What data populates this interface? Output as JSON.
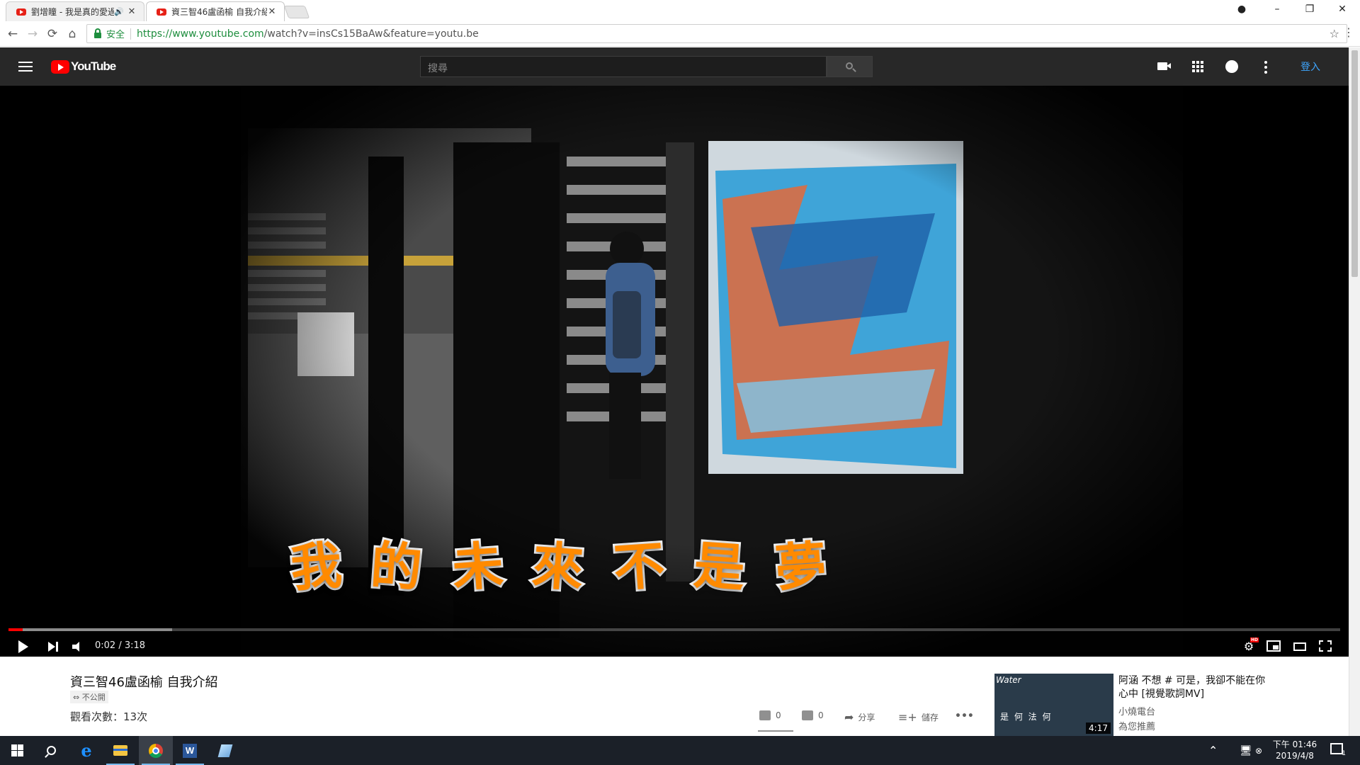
{
  "browser": {
    "tabs": [
      {
        "title": "劉增瞳 - 我是真的愛過",
        "active": false
      },
      {
        "title": "資三智46盧函榆 自我介紹",
        "active": true
      }
    ],
    "window_controls": {
      "minimize": "–",
      "restore": "❐",
      "close": "✕",
      "account": "●"
    },
    "nav": {
      "back": "←",
      "forward": "→",
      "reload": "⟳",
      "home": "⌂"
    },
    "security_label": "安全",
    "url_scheme_host": "https://www.youtube.com",
    "url_rest": "/watch?v=insCs15BaAw&feature=youtu.be",
    "bookmark_icon": "☆",
    "menu_icon": "⋮"
  },
  "youtube": {
    "logo_text": "YouTube",
    "search_placeholder": "搜尋",
    "signin_label": "登入",
    "header_icons": [
      "upload-video-icon",
      "apps-icon",
      "messages-icon",
      "settings-more-icon"
    ]
  },
  "player": {
    "caption_chars": [
      "我",
      "的",
      "未",
      "來",
      "不",
      "是",
      "夢"
    ],
    "time_display": "0:02 / 3:18",
    "progress": {
      "played_fraction": 0.0105,
      "buffered_fraction": 0.123
    },
    "hd_badge": "HD",
    "settings_icon": "⚙"
  },
  "video": {
    "title": "資三智46盧函榆 自我介紹",
    "privacy": "⇔ 不公開",
    "views": "觀看次數：13次",
    "likes": "0",
    "dislikes": "0",
    "share_label": "分享",
    "save_label": "儲存",
    "more_label": "•••"
  },
  "recommendation": {
    "title": "阿涵 不想 # 可是，我卻不能在你心中 [視覺歌詞MV]",
    "channel": "小燒電台",
    "reason": "為您推薦",
    "duration": "4:17",
    "thumb_watermark": "Water",
    "thumb_text": "是 何 法 何"
  },
  "taskbar": {
    "clock_time": "下午 01:46",
    "clock_date": "2019/4/8",
    "word_icon_letter": "W",
    "tray_up": "⌃",
    "notification_count": "1"
  },
  "colors": {
    "yt_header_bg": "#282828",
    "yt_red": "#ff0000",
    "signin_blue": "#3ea6ff",
    "caption_orange": "#ff8a00",
    "secure_green": "#1e8e3e",
    "taskbar_bg": "#1b2028"
  }
}
